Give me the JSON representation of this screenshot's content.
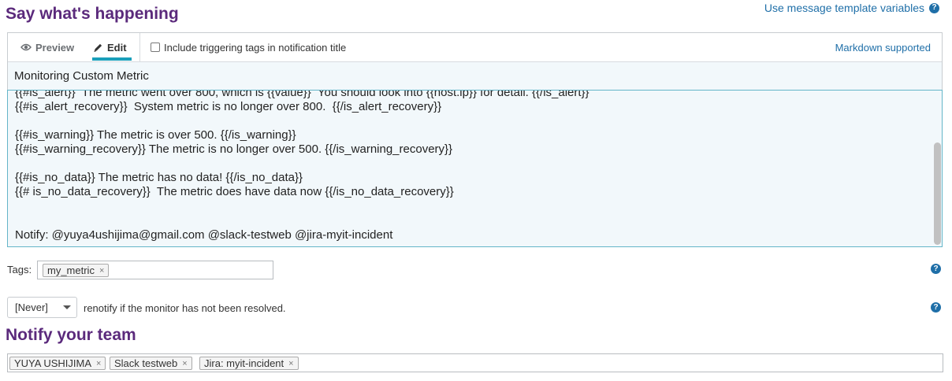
{
  "header": {
    "title": "Say what's happening",
    "template_link": "Use message template variables"
  },
  "editor": {
    "tabs": [
      {
        "label": "Preview",
        "icon": "eye-icon"
      },
      {
        "label": "Edit",
        "icon": "pencil-icon"
      }
    ],
    "checkbox_label": "Include triggering tags in notification title",
    "markdown_link": "Markdown supported",
    "title_value": "Monitoring Custom Metric",
    "body_lines": [
      "{{#is_alert}}  The metric went over 800, which is {{value}}  You should look into {{host.ip}} for detail. {{/is_alert}}",
      "{{#is_alert_recovery}}  System metric is no longer over 800.  {{/is_alert_recovery}}",
      "{{#is_warning}} The metric is over 500. {{/is_warning}}",
      "{{#is_warning_recovery}} The metric is no longer over 500. {{/is_warning_recovery}}",
      "{{#is_no_data}} The metric has no data! {{/is_no_data}}",
      "{{# is_no_data_recovery}}  The metric does have data now {{/is_no_data_recovery}}",
      "Notify: @yuya4ushijima@gmail.com @slack-testweb @jira-myit-incident"
    ]
  },
  "tags": {
    "label": "Tags:",
    "items": [
      "my_metric"
    ]
  },
  "renotify": {
    "value": "[Never]",
    "text": "renotify if the monitor has not been resolved."
  },
  "team": {
    "title": "Notify your team",
    "items": [
      "YUYA USHIJIMA",
      "Slack testweb",
      "Jira: myit-incident"
    ]
  },
  "icons": {
    "help": "?",
    "remove": "×"
  },
  "colors": {
    "title": "#5b2a7c",
    "link": "#1f6fa8",
    "accent": "#1a9fba"
  }
}
